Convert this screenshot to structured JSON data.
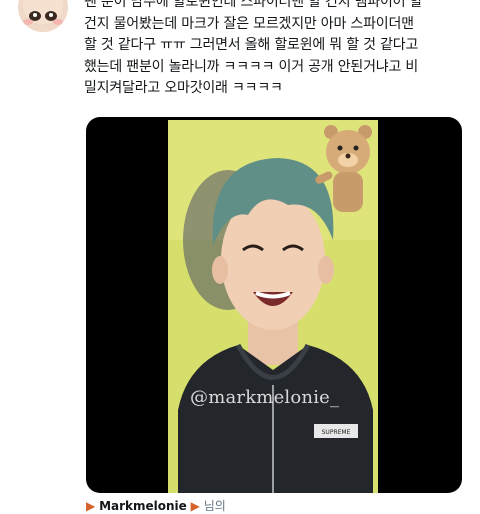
{
  "avatar": {
    "icon": "baby-face-avatar-icon"
  },
  "tweet": {
    "lines": [
      "팬 분이 남주에 할로윈인데 스파이더맨 할 건지 뱀파이어 할",
      "건지 물어봤는데 마크가 잘은 모르겠지만 아마 스파이더맨",
      "할 것 같다구 ㅠㅠ 그러면서 올해 할로윈에 뭐 할 것 같다고",
      "했는데 팬분이 놀라니까 ㅋㅋㅋㅋ 이거 공개 안된거냐고 비",
      "밀지켜달라고 오마갓이래 ㅋㅋㅋㅋ"
    ]
  },
  "media": {
    "watermark": "@markmelonie_",
    "sticker": "bear-sticker-icon",
    "shirt_tag": "SUPREME",
    "colors": {
      "background": "#000000",
      "wall": "#d8e06a",
      "hair": "#5f8f86",
      "hoodie": "#23262b"
    }
  },
  "quoted": {
    "flag_left": "▶",
    "name": "Markmelonie",
    "flag_right": "▶",
    "handle": "님의"
  }
}
